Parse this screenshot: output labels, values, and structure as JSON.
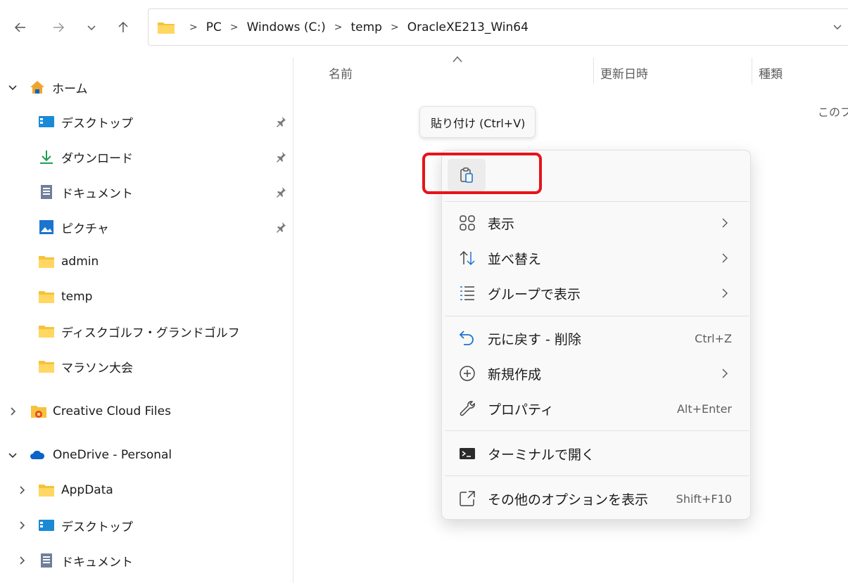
{
  "nav": {
    "back_icon": "arrow-left-icon",
    "forward_icon": "arrow-right-icon",
    "recent_icon": "chevron-down-icon",
    "up_icon": "arrow-up-icon"
  },
  "address": {
    "crumbs": [
      "PC",
      "Windows (C:)",
      "temp",
      "OracleXE213_Win64"
    ],
    "separator": ">"
  },
  "sidebar": {
    "home": "ホーム",
    "pinned": [
      {
        "label": "デスクトップ",
        "icon": "desktop-icon"
      },
      {
        "label": "ダウンロード",
        "icon": "download-icon"
      },
      {
        "label": "ドキュメント",
        "icon": "document-icon"
      },
      {
        "label": "ピクチャ",
        "icon": "pictures-icon"
      }
    ],
    "folders": [
      "admin",
      "temp",
      "ディスクゴルフ・グランドゴルフ",
      "マラソン大会"
    ],
    "creative_cloud": "Creative Cloud Files",
    "onedrive": "OneDrive - Personal",
    "onedrive_children": [
      {
        "label": "AppData",
        "icon": "folder-icon"
      },
      {
        "label": "デスクトップ",
        "icon": "desktop-icon"
      },
      {
        "label": "ドキュメント",
        "icon": "document-icon"
      }
    ]
  },
  "columns": {
    "name": "名前",
    "modified": "更新日時",
    "type": "種類"
  },
  "empty_message": "このフ",
  "tooltip": "貼り付け (Ctrl+V)",
  "context_menu": {
    "paste_icon": "paste-icon",
    "items": [
      {
        "label": "表示",
        "icon": "view-icon",
        "submenu": true
      },
      {
        "label": "並べ替え",
        "icon": "sort-icon",
        "submenu": true
      },
      {
        "label": "グループで表示",
        "icon": "group-icon",
        "submenu": true
      },
      {
        "label": "元に戻す - 削除",
        "icon": "undo-icon",
        "shortcut": "Ctrl+Z"
      },
      {
        "label": "新規作成",
        "icon": "new-icon",
        "submenu": true
      },
      {
        "label": "プロパティ",
        "icon": "wrench-icon",
        "shortcut": "Alt+Enter"
      },
      {
        "label": "ターミナルで開く",
        "icon": "terminal-icon"
      },
      {
        "label": "その他のオプションを表示",
        "icon": "more-options-icon",
        "shortcut": "Shift+F10"
      }
    ]
  },
  "colors": {
    "folder": "#f5c33b",
    "accent": "#0067c0",
    "highlight": "#e8131a"
  }
}
